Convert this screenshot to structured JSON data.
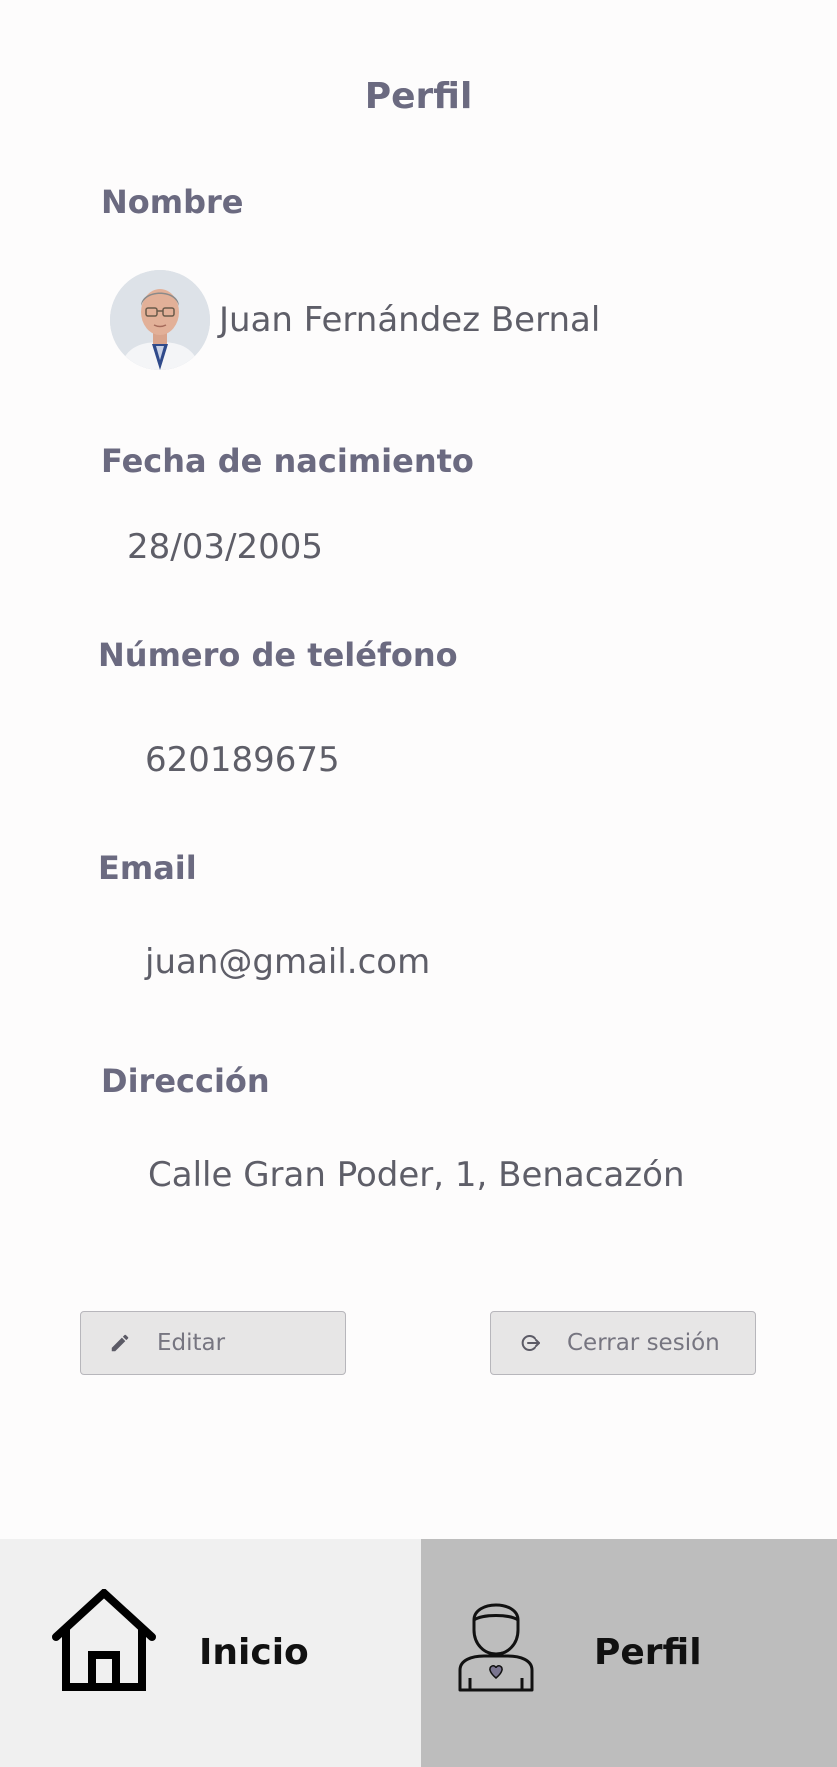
{
  "page": {
    "title": "Perfil"
  },
  "profile": {
    "name_label": "Nombre",
    "name": "Juan Fernández Bernal",
    "birth_label": "Fecha de nacimiento",
    "birth": "28/03/2005",
    "phone_label": "Número de teléfono",
    "phone": "620189675",
    "email_label": "Email",
    "email": "juan@gmail.com",
    "address_label": "Dirección",
    "address": "Calle Gran Poder, 1, Benacazón"
  },
  "actions": {
    "edit_label": "Editar",
    "edit_icon": "pencil-icon",
    "logout_label": "Cerrar sesión",
    "logout_icon": "logout-icon"
  },
  "nav": {
    "items": [
      {
        "label": "Inicio",
        "icon": "home-icon",
        "active": false
      },
      {
        "label": "Perfil",
        "icon": "user-icon",
        "active": true
      }
    ]
  },
  "colors": {
    "label": "#6b6a80",
    "value": "#5e5e68",
    "button_bg": "#e7e6e6",
    "nav_inactive_bg": "#f0f0f0",
    "nav_active_bg": "#bdbdbd"
  }
}
